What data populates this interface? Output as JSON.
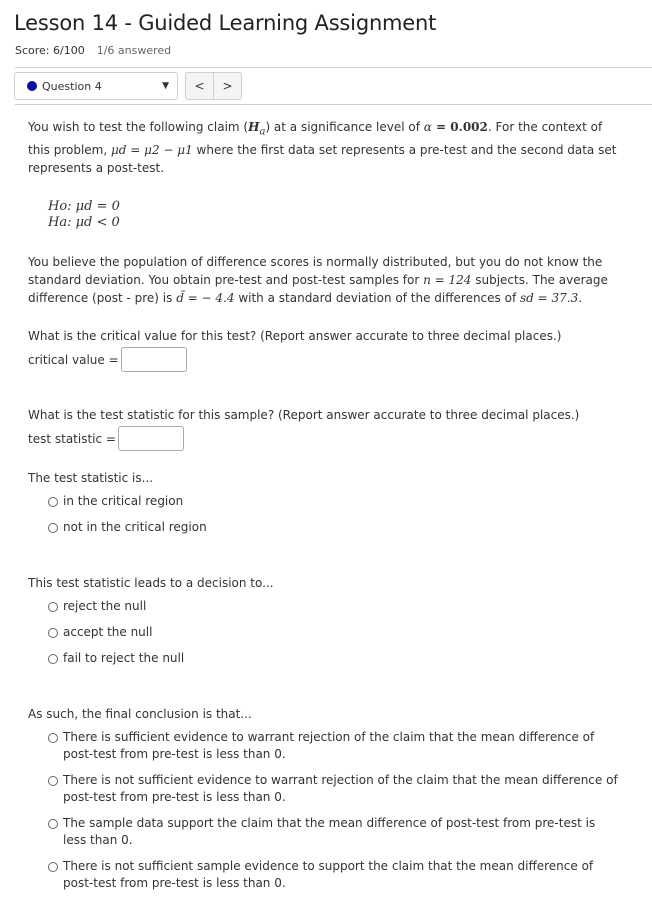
{
  "header": {
    "title": "Lesson 14 - Guided Learning Assignment",
    "score": "Score: 6/100",
    "answered": "1/6 answered"
  },
  "navigation": {
    "question_select": "Question 4",
    "prev_label": "<",
    "next_label": ">",
    "status_dot_color": "#0b0b9c"
  },
  "problem": {
    "intro_1": "You wish to test the following claim (",
    "intro_claim": "H",
    "intro_claim_sub": "a",
    "intro_2": ") at a significance level of ",
    "alpha_symbol": "α",
    "alpha_value": "0.002",
    "intro_3": ". For the context of this problem, ",
    "mu_d_def": "μd = μ2 − μ1",
    "intro_4": " where the first data set represents a pre-test and the second data set represents a post-test.",
    "null_hypothesis": "Ho: μd = 0",
    "alt_hypothesis": "Ha: μd < 0",
    "setup_1": "You believe the population of difference scores is normally distributed, but you do not know the standard deviation. You obtain pre-test and post-test samples for ",
    "n_expr": "n = 124",
    "setup_2": " subjects. The average difference (post - pre) is ",
    "dbar_expr": "d̄ = − 4.4",
    "setup_3": " with a standard deviation of the differences of ",
    "sd_expr": "sd = 37.3",
    "setup_4": "."
  },
  "questions": {
    "critical": {
      "prompt": "What is the critical value for this test? (Report answer accurate to three decimal places.)",
      "label": "critical value =",
      "value": ""
    },
    "statistic": {
      "prompt": "What is the test statistic for this sample? (Report answer accurate to three decimal places.)",
      "label": "test statistic =",
      "value": ""
    },
    "region": {
      "prompt": "The test statistic is...",
      "options": [
        "in the critical region",
        "not in the critical region"
      ]
    },
    "decision": {
      "prompt": "This test statistic leads to a decision to...",
      "options": [
        "reject the null",
        "accept the null",
        "fail to reject the null"
      ]
    },
    "conclusion": {
      "prompt": "As such, the final conclusion is that...",
      "options": [
        "There is sufficient evidence to warrant rejection of the claim that the mean difference of post-test from pre-test is less than 0.",
        "There is not sufficient evidence to warrant rejection of the claim that the mean difference of post-test from pre-test is less than 0.",
        "The sample data support the claim that the mean difference of post-test from pre-test is less than 0.",
        "There is not sufficient sample evidence to support the claim that the mean difference of post-test from pre-test is less than 0."
      ]
    }
  }
}
